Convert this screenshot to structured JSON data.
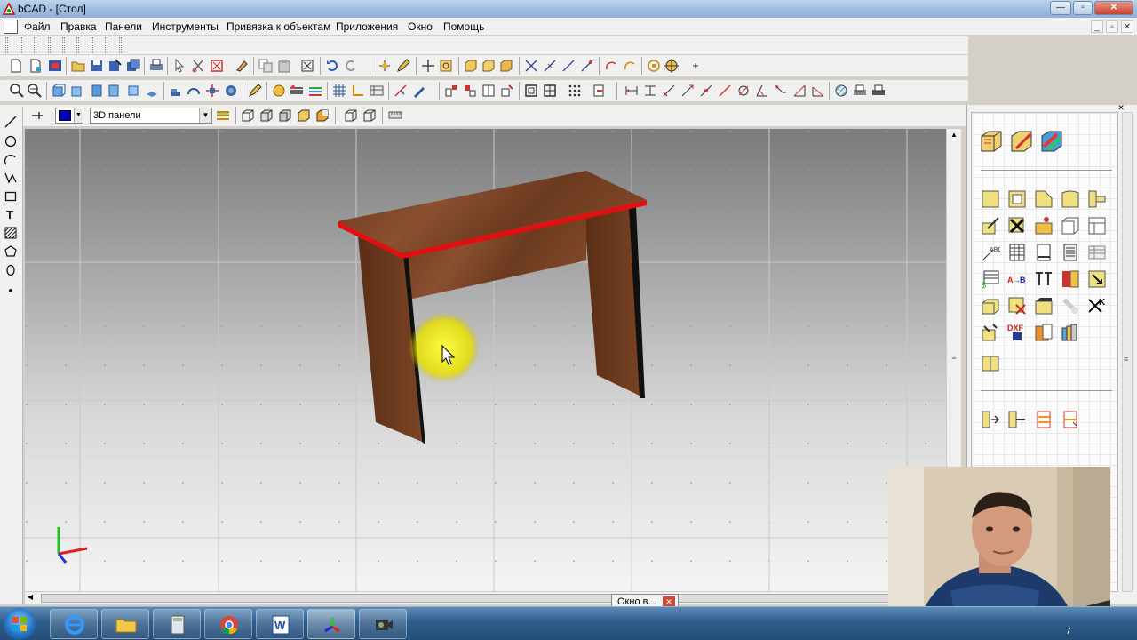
{
  "window": {
    "title": "bCAD - [Стол]"
  },
  "menu": {
    "items": [
      {
        "label": "Файл"
      },
      {
        "label": "Правка"
      },
      {
        "label": "Панели"
      },
      {
        "label": "Инструменты"
      },
      {
        "label": "Привязка к объектам"
      },
      {
        "label": "Приложения"
      },
      {
        "label": "Окно"
      },
      {
        "label": "Помощь"
      }
    ]
  },
  "toolbar3": {
    "color_swatch": "#0000c0",
    "layer_combo_value": "3D панели"
  },
  "table_colors": {
    "wood": "#6b3a1f",
    "edge": "#e01010"
  },
  "popup": {
    "label": "Окно в..."
  },
  "taskbar": {
    "clock": "7"
  }
}
